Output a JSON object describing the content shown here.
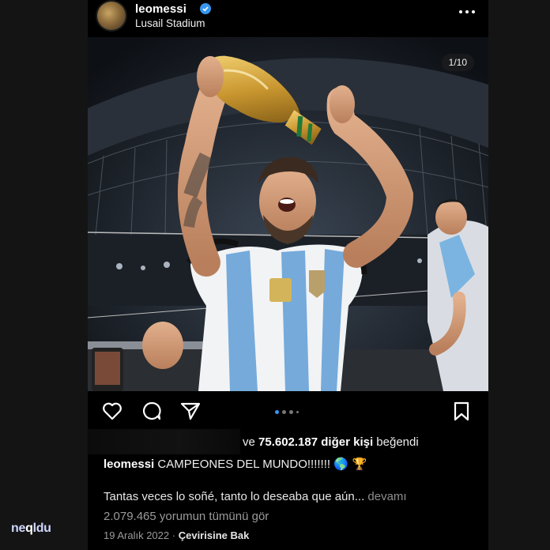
{
  "post": {
    "username": "leomessi",
    "location": "Lusail Stadium",
    "slide_counter": "1/10",
    "carousel": {
      "total_dots": 4,
      "active_index": 0
    }
  },
  "engagement": {
    "likes_prefix": "ve",
    "likes_count": "75.602.187 diğer kişi",
    "likes_suffix": "beğendi"
  },
  "caption": {
    "username": "leomessi",
    "text": "CAMPEONES DEL MUNDO!!!!!!!",
    "emoji": "🌎 🏆",
    "second_line": "Tantas veces lo soñé, tanto lo deseaba que aún...",
    "more_label": "devamı"
  },
  "comments_link": "2.079.465 yorumun tümünü gör",
  "date": "19 Aralık 2022",
  "separator": "·",
  "translate_label": "Çevirisine Bak",
  "watermark": {
    "part1": "ne",
    "part2": "q",
    "part3": "ldu"
  },
  "icons": [
    "verified-badge-icon",
    "more-options-icon",
    "heart-icon",
    "comment-icon",
    "share-icon",
    "bookmark-icon"
  ],
  "colors": {
    "verified": "#3797f0",
    "background": "#000000",
    "muted_text": "#9a9a9a"
  }
}
